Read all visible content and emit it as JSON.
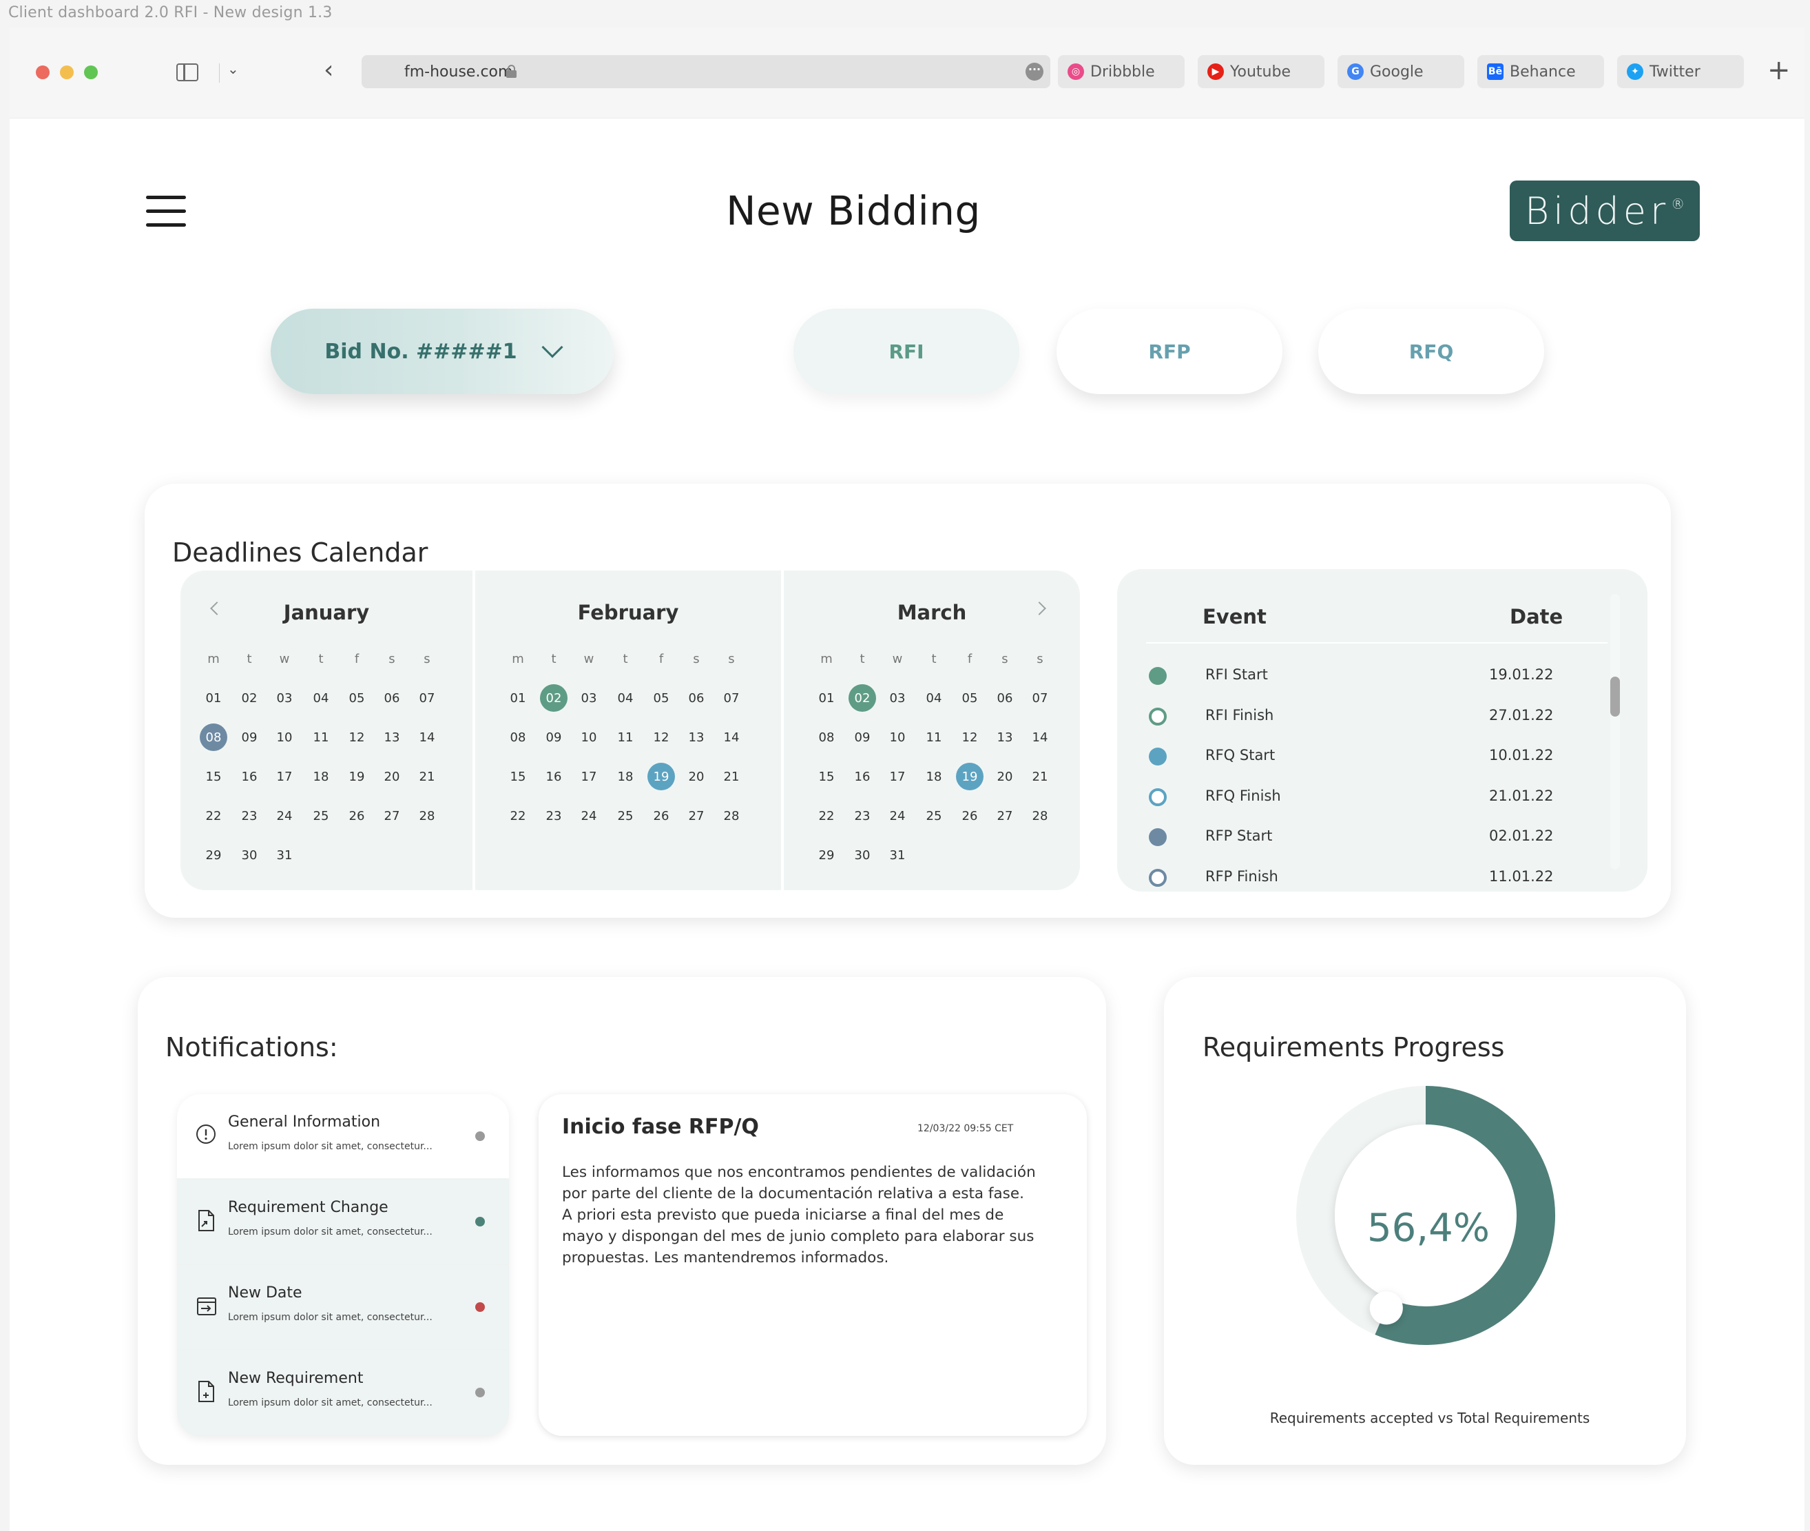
{
  "frame_label": "Client dashboard 2.0 RFI - New design 1.3",
  "browser": {
    "url": "fm-house.com",
    "bookmarks": [
      {
        "label": "Dribbble",
        "icon": "dribbble-icon",
        "color": "#ea4c89"
      },
      {
        "label": "Youtube",
        "icon": "youtube-icon",
        "color": "#e62117"
      },
      {
        "label": "Google",
        "icon": "google-icon",
        "color": "#4285f4"
      },
      {
        "label": "Behance",
        "icon": "behance-icon",
        "color": "#1769ff"
      },
      {
        "label": "Twitter",
        "icon": "twitter-icon",
        "color": "#1da1f2"
      }
    ]
  },
  "header": {
    "title": "New Bidding",
    "logo": "Bidder",
    "logo_mark": "®"
  },
  "bid_selector": {
    "label": "Bid No. #####1"
  },
  "phase_tabs": [
    {
      "label": "RFI",
      "active": true
    },
    {
      "label": "RFP",
      "active": false
    },
    {
      "label": "RFQ",
      "active": false
    }
  ],
  "calendar": {
    "title": "Deadlines Calendar",
    "weekdays": [
      "m",
      "t",
      "w",
      "t",
      "f",
      "s",
      "s"
    ],
    "months": [
      {
        "name": "January",
        "days": 31,
        "marks": [
          {
            "day": "08",
            "color": "#6e8aa3"
          }
        ]
      },
      {
        "name": "February",
        "days": 28,
        "marks": [
          {
            "day": "02",
            "color": "#5f9c85"
          },
          {
            "day": "19",
            "color": "#5ca3c2"
          }
        ]
      },
      {
        "name": "March",
        "days": 31,
        "marks": [
          {
            "day": "02",
            "color": "#5f9c85"
          },
          {
            "day": "19",
            "color": "#5ca3c2"
          }
        ]
      }
    ],
    "events_header": {
      "event": "Event",
      "date": "Date"
    },
    "events": [
      {
        "name": "RFI Start",
        "date": "19.01.22",
        "color": "#5f9c85",
        "filled": true
      },
      {
        "name": "RFI Finish",
        "date": "27.01.22",
        "color": "#5f9c85",
        "filled": false
      },
      {
        "name": "RFQ Start",
        "date": "10.01.22",
        "color": "#5ca3c2",
        "filled": true
      },
      {
        "name": "RFQ Finish",
        "date": "21.01.22",
        "color": "#5ca3c2",
        "filled": false
      },
      {
        "name": "RFP Start",
        "date": "02.01.22",
        "color": "#6e8aa3",
        "filled": true
      },
      {
        "name": "RFP Finish",
        "date": "11.01.22",
        "color": "#6e8aa3",
        "filled": false
      }
    ]
  },
  "notifications": {
    "title": "Notifications:",
    "items": [
      {
        "title": "General Information",
        "subtitle": "Lorem ipsum dolor sit amet, consectetur...",
        "icon": "info-icon",
        "dot_color": "#9a9a9a",
        "selected": true
      },
      {
        "title": "Requirement Change",
        "subtitle": "Lorem ipsum dolor sit amet, consectetur...",
        "icon": "document-edit-icon",
        "dot_color": "#4d8279",
        "selected": false
      },
      {
        "title": "New Date",
        "subtitle": "Lorem ipsum dolor sit amet, consectetur...",
        "icon": "calendar-login-icon",
        "dot_color": "#c24a4a",
        "selected": false
      },
      {
        "title": "New Requirement",
        "subtitle": "Lorem ipsum dolor sit amet, consectetur...",
        "icon": "document-add-icon",
        "dot_color": "#9a9a9a",
        "selected": false
      }
    ],
    "detail": {
      "title": "Inicio fase RFP/Q",
      "timestamp": "12/03/22 09:55 CET",
      "body": "Les informamos que nos encontramos pendientes de validación por parte del cliente de la documentación relativa a esta fase. A priori esta previsto que pueda iniciarse a final del mes de mayo y dispongan del mes de junio completo para elaborar sus propuestas. Les mantendremos informados."
    }
  },
  "progress": {
    "title": "Requirements Progress",
    "value_label": "56,4%",
    "fraction": 0.564,
    "caption": "Requirements accepted vs Total Requirements",
    "color": "#4f7f79"
  }
}
